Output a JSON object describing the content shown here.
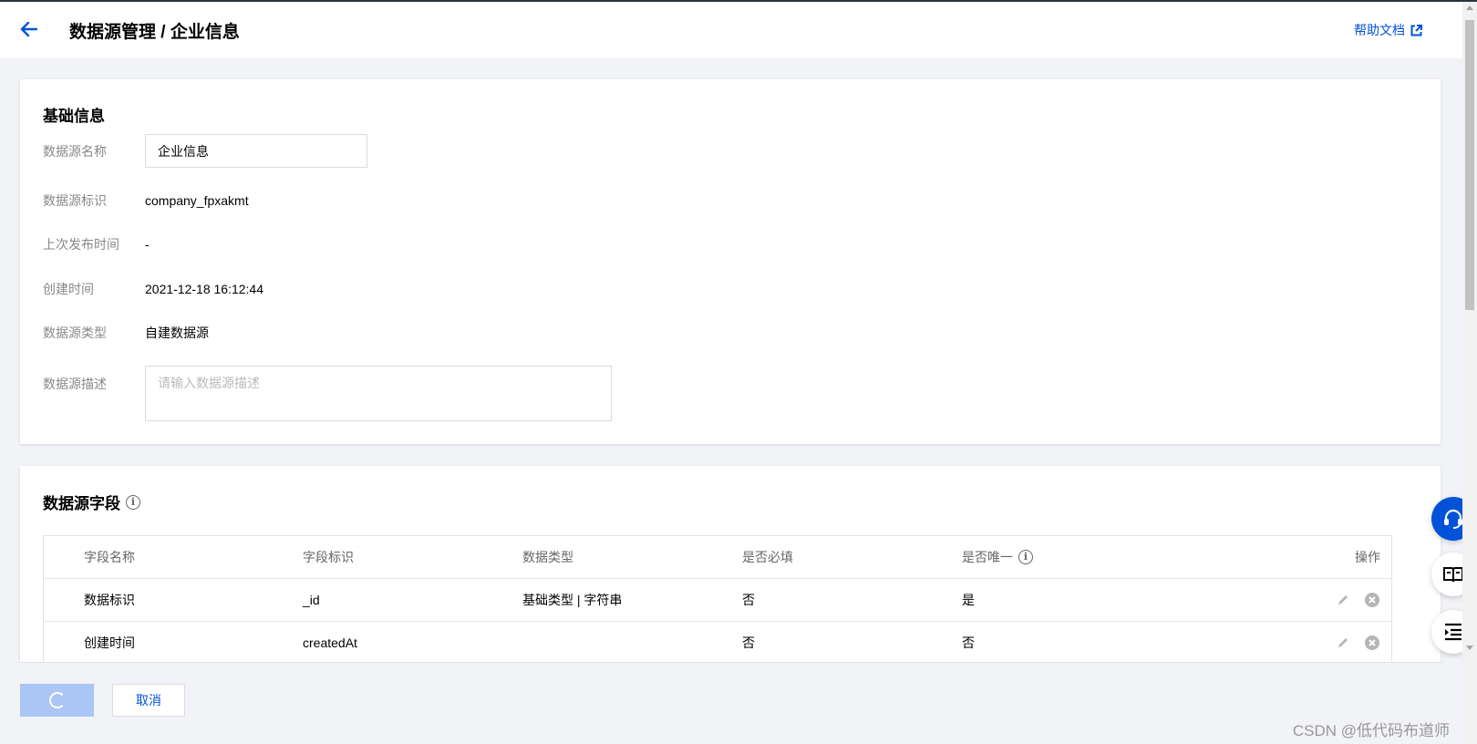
{
  "header": {
    "title": "数据源管理 / 企业信息",
    "help_label": "帮助文档"
  },
  "basic_info": {
    "section_title": "基础信息",
    "fields": {
      "name_label": "数据源名称",
      "name_value": "企业信息",
      "id_label": "数据源标识",
      "id_value": "company_fpxakmt",
      "publish_label": "上次发布时间",
      "publish_value": "-",
      "created_label": "创建时间",
      "created_value": "2021-12-18 16:12:44",
      "type_label": "数据源类型",
      "type_value": "自建数据源",
      "desc_label": "数据源描述",
      "desc_placeholder": "请输入数据源描述"
    }
  },
  "fields_section": {
    "section_title": "数据源字段",
    "columns": [
      "字段名称",
      "字段标识",
      "数据类型",
      "是否必填",
      "是否唯一",
      "操作"
    ],
    "rows": [
      {
        "name": "数据标识",
        "key": "_id",
        "type": "基础类型 | 字符串",
        "required": "否",
        "unique": "是"
      },
      {
        "name": "创建时间",
        "key": "createdAt",
        "type": "",
        "required": "否",
        "unique": "否"
      }
    ]
  },
  "footer": {
    "cancel_label": "取消",
    "watermark": "CSDN @低代码布道师"
  },
  "colors": {
    "primary": "#0052d9",
    "primary_disabled": "#a9c6f5",
    "page_bg": "#f2f3f7"
  }
}
